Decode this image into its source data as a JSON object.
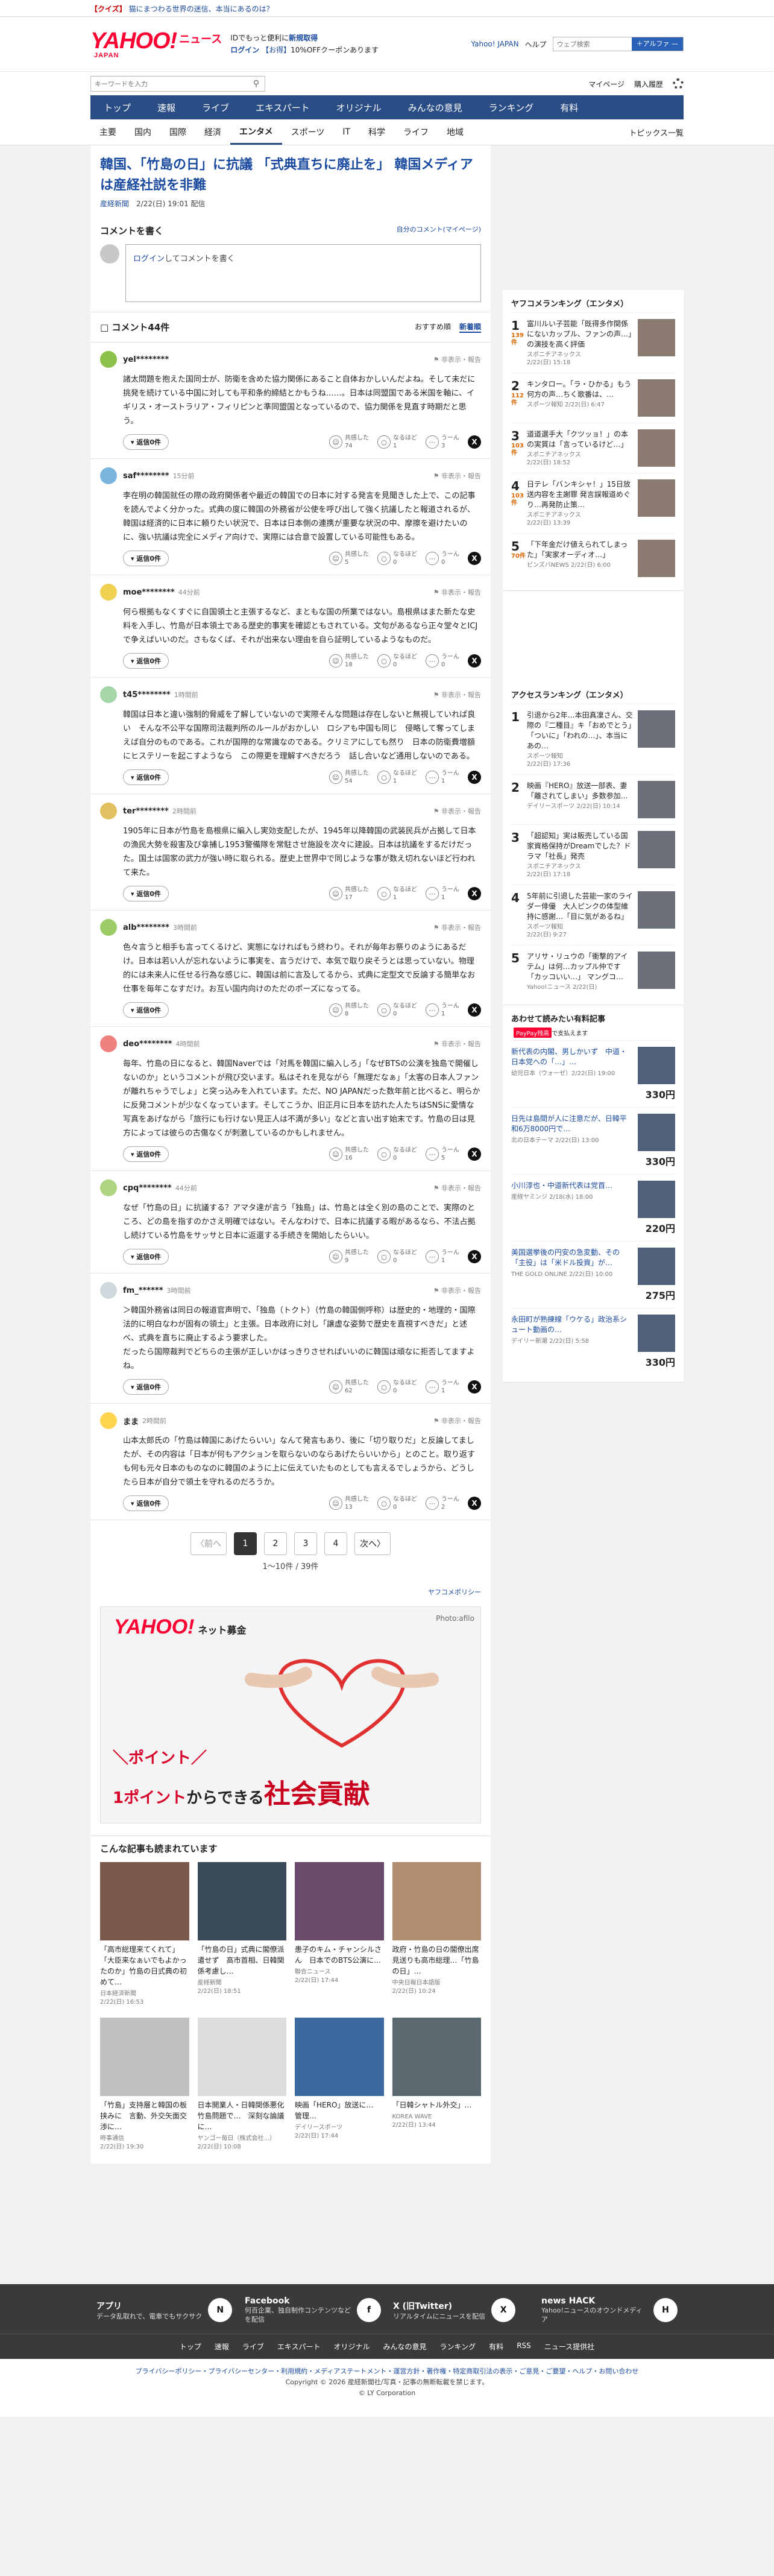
{
  "topbar": {
    "quiz_tag": "【クイズ】",
    "quiz_text": "猫にまつわる世界の迷信、本当にあるのは？"
  },
  "header": {
    "logo": "YAHOO!",
    "logo_sub": "JAPAN",
    "section": "ニュース",
    "promo1_a": "IDでもっと便利に",
    "promo1_b": "新規取得",
    "promo2_a": "ログイン",
    "promo2_b": "【お得】",
    "promo2_c": "10%OFFクーポンあります",
    "links": [
      "Yahoo! JAPAN",
      "ヘルプ"
    ],
    "search_placeholder": "ウェブ検索",
    "search_btn": "＋アルファ —"
  },
  "searchrow": {
    "placeholder": "キーワードを入力",
    "mypage": "マイページ",
    "purchased": "購入履歴"
  },
  "mainnav": [
    "トップ",
    "速報",
    "ライブ",
    "エキスパート",
    "オリジナル",
    "みんなの意見",
    "ランキング",
    "有料"
  ],
  "subnav": [
    "主要",
    "国内",
    "国際",
    "経済",
    "エンタメ",
    "スポーツ",
    "IT",
    "科学",
    "ライフ",
    "地域"
  ],
  "subnav_topics": "トピックス一覧",
  "article": {
    "title": "韓国、「竹島の日」に抗議 「式典直ちに廃止を」 韓国メディアは産経社説を非難",
    "source": "産経新聞",
    "date": "2/22(日) 19:01 配信"
  },
  "comment_write": {
    "heading": "コメントを書く",
    "my_comments": "自分のコメント(マイページ)",
    "login_link": "ログイン",
    "placeholder": "してコメントを書く"
  },
  "comments_header": {
    "title": "コメント44件",
    "sort_recommended": "おすすめ順",
    "sort_new": "新着順"
  },
  "reply_label": "返信0件",
  "vote_labels": {
    "agree": "共感した",
    "think": "なるほど",
    "hmm": "うーん"
  },
  "report_label": "非表示・報告",
  "comments": [
    {
      "user": "yel********",
      "time": "",
      "body": "諸太問題を抱えた国同士が、防衛を含めた協力関係にあること自体おかしいんだよね。そして未だに挑発を続けている中国に対しても平和条約締結とかもうね……。日本は同盟国である米国を軸に、イギリス・オーストラリア・フィリピンと準同盟国となっているので、協力関係を見直す時期だと思う。",
      "agree": "74",
      "think": "1",
      "hmm": "3",
      "color": "#8bc34a"
    },
    {
      "user": "saf********",
      "time": "15分前",
      "body": "李在明の韓国就任の際の政府関係者や最近の韓国での日本に対する発言を見聞きした上で、この記事を読んでよく分かった。式典の度に韓国の外務省が公使を呼び出して強く抗議したと報道されるが、韓国は経済的に日本に頼りたい状況で、日本は日本側の連携が重要な状況の中、摩擦を避けたいのに、強い抗議は完全にメディア向けで、実際には合意で設置している可能性もある。",
      "agree": "5",
      "think": "0",
      "hmm": "0",
      "color": "#7cb4e0"
    },
    {
      "user": "moe********",
      "time": "44分前",
      "body": "何ら根拠もなくすぐに自国領土と主張するなど、まともな国の所業ではない。島根県はまた新たな史料を入手し、竹島が日本領土である歴史的事実を確認ともされている。文句があるなら正々堂々とICJで争えばいいのだ。さもなくば、それが出来ない理由を自ら証明しているようなものだ。",
      "agree": "18",
      "think": "0",
      "hmm": "0",
      "color": "#f0d050"
    },
    {
      "user": "t45********",
      "time": "1時間前",
      "body": "韓国は日本と違い強制的脅威を了解していないので実際そんな問題は存在しないと無視していれば良い　そんな不公平な国際司法裁判所のルールがおかしい　ロシアも中国も同じ　侵略して奪ってしまえば自分のものである。これが国際的な常識なのである。クリミアにしても然り　日本の防衛費増額にヒステリーを起こすようなら　この際更を理解すべきだろう　話し合いなど通用しないのである。",
      "agree": "54",
      "think": "1",
      "hmm": "1",
      "color": "#a5d6a7"
    },
    {
      "user": "ter********",
      "time": "2時間前",
      "body": "1905年に日本が竹島を島根県に編入し実効支配したが、1945年以降韓国の武装民兵が占拠して日本の漁民大勢を殺害及び拿捕し1953警備隊を常駐させ施設を次々に建設。日本は抗議をするだけだった。国土は国家の武力が強い時に取られる。歴史上世界中で同じような事が数え切れないほど行われて来た。",
      "agree": "17",
      "think": "1",
      "hmm": "1",
      "color": "#e0c060"
    },
    {
      "user": "alb********",
      "time": "3時間前",
      "body": "色々言うと相手も言ってくるけど、実態になければもう終わり。それが毎年お祭りのようにあるだけ。日本は若い人が忘れないように事実を、言うだけで、本気で取り戻そうとは思っていない。物理的には未来人に任せる行為な感じに、韓国は前に言及してるから、式典に定型文で反論する簡単なお仕事を毎年こなすだけ。お互い国内向けのただのポーズになってる。",
      "agree": "8",
      "think": "0",
      "hmm": "1",
      "color": "#9ccc65"
    },
    {
      "user": "deo********",
      "time": "4時間前",
      "body": "毎年、竹島の日になると、韓国Naverでは「対馬を韓国に編入しろ」「なぜBTSの公演を独島で開催しないのか」というコメントが飛び交います。私はそれを見ながら「無理だなぁ」「太客の日本人ファンが離れちゃうでしょ」と突っ込みを入れています。ただ、NO JAPANだった数年前と比べると、明らかに反発コメントが少なくなっています。そしてこうか、旧正月に日本を訪れた人たちはSNSに愛情な写真をあげながら「旅行にも行けない見正人は不満が多い」などと言い出す始末です。竹島の日は見方によっては彼らの古傷なくが刺激しているのかもしれません。",
      "agree": "16",
      "think": "0",
      "hmm": "5",
      "color": "#f08080"
    },
    {
      "user": "cpq********",
      "time": "44分前",
      "body": "なぜ「竹島の日」に抗議する？アマタ達が言う「独島」は、竹島とは全く別の島のことで、実際のところ、どの島を指すのかさえ明確ではない。そんなわけで、日本に抗議する暇があるなら、不法占拠し続けている竹島をサッサと日本に返還する手続きを開始したらいい。",
      "agree": "9",
      "think": "0",
      "hmm": "1",
      "color": "#aed581"
    },
    {
      "user": "fm_******",
      "time": "3時間前",
      "body": "＞韓国外務省は同日の報道官声明で、「独島（トクト）（竹島の韓国側呼称）は歴史的・地理的・国際法的に明白なわが固有の領土」と主張。日本政府に対し「譲虚な姿勢で歴史を直視すべきだ」と述べ、式典を直ちに廃止するよう要求した。\nだったら国際裁判でどちらの主張が正しいかはっきりさせればいいのに韓国は頑なに拒否してますよね。",
      "agree": "62",
      "think": "0",
      "hmm": "1",
      "color": "#cfd8dc"
    },
    {
      "user": "まま",
      "time": "2時間前",
      "body": "山本太郎氏の「竹島は韓国にあげたらいい」なんて発言もあり、後に「切り取りだ」と反論してましたが、その内容は「日本が何もアクションを取らないのならあげたらいいから」とのこと。取り返すも何も元々日本のものなのに韓国のように上に伝えていたものとしても言えるでしょうから、どうしたら日本が自分で領土を守れるのだろうか。",
      "agree": "13",
      "think": "0",
      "hmm": "2",
      "color": "#ffd54f"
    }
  ],
  "pager": {
    "prev": "〈前へ",
    "pages": [
      "1",
      "2",
      "3",
      "4"
    ],
    "next": "次へ〉",
    "count": "1〜10件 / 39件"
  },
  "policy_link": "ヤフコメポリシー",
  "ad": {
    "logo": "YAHOO!",
    "logo_sub": "JAPAN",
    "brand": "ネット募金",
    "photo": "Photo:afilo",
    "line1": "＼ポイント／",
    "line2a": "1ポイント",
    "line2b": "からできる",
    "line2c": "社会貢献"
  },
  "related": {
    "title": "こんな記事も読まれています",
    "items": [
      {
        "t": "「高市総理来てくれて」「大臣来なぁいでもよかったのか」竹島の日式典の初めて…",
        "s": "日本経済新聞\n2/22(日) 16:53",
        "c": "#7a5a4a"
      },
      {
        "t": "「竹島の日」式典に閣僚派遣せず　高市首相、日韓関係考慮し…",
        "s": "産経新聞\n2/22(日) 18:51",
        "c": "#3a4a5a"
      },
      {
        "t": "患子のキム・チャンシルさん　日本でのBTS公演に…",
        "s": "聯合ニュース\n2/22(日) 17:44",
        "c": "#6a4a6a"
      },
      {
        "t": "政府・竹島の日の閣僚出席見送りも高市総理…「竹島の日」…",
        "s": "中央日報日本語版\n2/22(日) 10:24",
        "c": "#b09070"
      },
      {
        "t": "「竹島」支持層と韓国の板挟みに　言動、外交矢面交渉に…",
        "s": "時事通信\n2/22(日) 19:30",
        "c": "#c0c0c0"
      },
      {
        "t": "日本開業人・日韓関係悪化　竹島問題で…　深刻な論議に…",
        "s": "ヤンゴー毎日（株式会社...）\n2/22(日) 10:08",
        "c": "#dddddd"
      },
      {
        "t": "映画「HERO」放送に…　管理…",
        "s": "デイリースポーツ\n2/22(日) 17:44",
        "c": "#3a6aa0"
      },
      {
        "t": "「日韓シャトル外交」…",
        "s": "KOREA WAVE\n2/22(日) 13:44",
        "c": "#5a6a70"
      }
    ]
  },
  "sidebar": {
    "rank_title": "ヤフコメランキング（エンタメ）",
    "rank": [
      {
        "n": "1",
        "c": "139件",
        "t": "富川ルい子芸能「既得多作関係にないカップル、ファンの声…」の演技を高く評価",
        "s": "スポニチアネックス\n2/22(日) 15:18"
      },
      {
        "n": "2",
        "c": "112件",
        "t": "キンタロー。「ラ・ひかる」もう何方の声…ちく歌番は、…",
        "s": "スポーツ報知 2/22(日) 6:47"
      },
      {
        "t": "道道選手大「クツッョ！」の本の実質は「言っているけど…」",
        "n": "3",
        "c": "103件",
        "s": "スポニチアネックス\n2/22(日) 18:52"
      },
      {
        "n": "4",
        "c": "103件",
        "t": "日テレ「バンキシャ！」15日放送内容を主謝罪 発言誤報道めぐり…再発防止策…",
        "s": "スポニチアネックス\n2/22(日) 13:39"
      },
      {
        "n": "5",
        "c": "70件",
        "t": "「下年金だけ値えられてしまった」「実家オーディオ…」",
        "s": "ピンズバNEWS 2/22(日) 6:00"
      }
    ],
    "access_title": "アクセスランキング（エンタメ）",
    "access": [
      {
        "n": "1",
        "t": "引退から2年…本田真凜さん、交際の『二種目』キ「おめでとう」「ついに」「われの…」、本当にあの…",
        "s": "スポーツ報知\n2/22(日) 17:36"
      },
      {
        "n": "2",
        "t": "映画『HERO』放送一部表、妻「離されてしまい」多数参加…",
        "s": "デイリースポーツ 2/22(日) 10:14"
      },
      {
        "n": "3",
        "t": "「超認知」実は販売している国家資格保持がDreamでした？ドラマ「社長」発売",
        "s": "スポニチアネックス\n2/22(日) 17:18"
      },
      {
        "n": "4",
        "t": "5年前に引退した芸能一家のライダー俳優　大人ピンクの体型維持に感謝…「目に気があるね」",
        "s": "スポーツ報知\n2/22(日) 9:27"
      },
      {
        "n": "5",
        "t": "アリサ・リュウの「衝撃的アイテム」は何…カップル仲です「カッコいい…」 マングコ…",
        "s": "Yahoo!ニュース 2/22(日)"
      }
    ],
    "promo_title": "あわせて読みたい有料記事",
    "promo_brand": "PayPay残高",
    "promo_brand_suffix": "で支払えます",
    "promo": [
      {
        "t": "新代表の内閣、男しかいず　中道・日本党への「…」…",
        "s": "幼児日本（ウォーゼ）2/22(日) 19:00",
        "p": "330円"
      },
      {
        "t": "日先は島間が人に注意だが、日韓平和6万8000円で…",
        "s": "北の日本テーマ 2/22(日) 13:00",
        "p": "330円"
      },
      {
        "t": "小川淳也・中道新代表は党首…",
        "s": "産経ヤミンジ 2/18(水) 18:00",
        "p": "220円"
      },
      {
        "t": "美国選挙後の円安の急変動、その「主役」は「米ドル投資」が…",
        "s": "THE GOLD ONLINE\n2/22(日) 10:00",
        "p": "275円"
      },
      {
        "t": "永田町が熟練線「ウケる」政治系シュート動画の…",
        "s": "デイリー新潮 2/22(日) 5:58",
        "p": "330円"
      }
    ]
  },
  "footer": {
    "cols": [
      {
        "h": "アプリ",
        "d": "データ乱取れで、電車でもサクサク",
        "i": "N"
      },
      {
        "h": "Facebook",
        "d": "何百企業、独自制作コンテンツなどを配信",
        "i": "f"
      },
      {
        "h": "X (旧Twitter)",
        "d": "リアルタイムにニュースを配信",
        "i": "X"
      },
      {
        "h": "news HACK",
        "d": "Yahoo!ニュースのオウンドメディア",
        "i": "H"
      }
    ],
    "links": [
      "トップ",
      "速報",
      "ライブ",
      "エキスパート",
      "オリジナル",
      "みんなの意見",
      "ランキング",
      "有料",
      "RSS",
      "ニュース提供社"
    ],
    "legal": "プライバシーポリシー・プライバシーセンター・利用規約・メディアステートメント・運営方針・著作権・特定商取引法の表示・ご意見・ご要望・ヘルプ・お問い合わせ",
    "copyright": "Copyright © 2026 産経新聞社/写真・記事の無断転載を禁じます。",
    "copyright2": "© LY Corporation"
  }
}
